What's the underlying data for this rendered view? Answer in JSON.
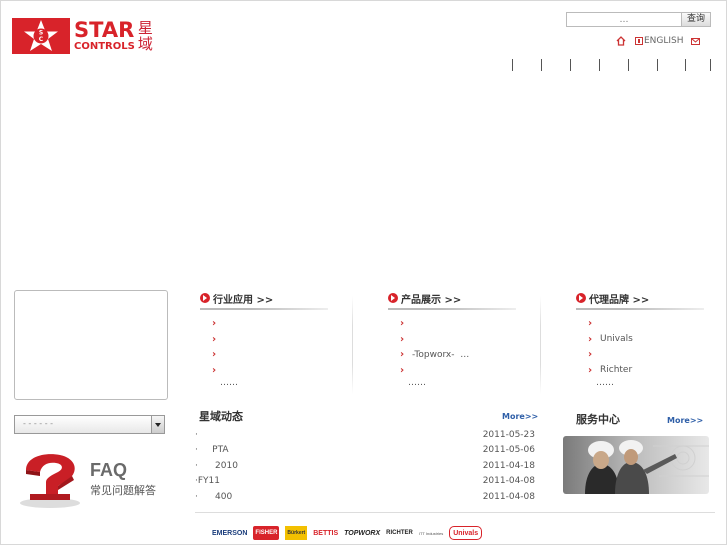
{
  "header": {
    "logo": {
      "brand": "STAR",
      "sub": "CONTROLS",
      "cn": "星域",
      "badge_letters": "SC"
    },
    "search": {
      "placeholder": "…",
      "button_label": "查询"
    },
    "toplinks": {
      "lang_label": "ENGLISH",
      "icons": [
        "home-icon",
        "language-icon",
        "mail-icon"
      ]
    },
    "nav_separators": 8
  },
  "sections": {
    "industry": {
      "title": "行业应用 >>",
      "items": [
        "",
        "",
        "",
        ""
      ],
      "more": "……"
    },
    "products": {
      "title": "产品展示 >>",
      "items": [
        "",
        "",
        "-Topworx-  …",
        ""
      ],
      "more": "……"
    },
    "brands": {
      "title": "代理品牌 >>",
      "items": [
        "",
        "Univals",
        "",
        "Richter"
      ],
      "more": "……"
    }
  },
  "left": {
    "select_value": "- - -     - - -",
    "faq": {
      "title": "FAQ",
      "subtitle": "常见问题解答"
    }
  },
  "news": {
    "title": "星域动态",
    "more": "More>>",
    "items": [
      {
        "title": "·",
        "date": "2011-05-23"
      },
      {
        "title": "·     PTA",
        "date": "2011-05-06"
      },
      {
        "title": "·      2010",
        "date": "2011-04-18"
      },
      {
        "title": "·FY11",
        "date": "2011-04-08"
      },
      {
        "title": "·      400",
        "date": "2011-04-08"
      }
    ]
  },
  "service": {
    "title": "服务中心",
    "more": "More>>"
  },
  "footer_brands": [
    "EMERSON",
    "FISHER",
    "Bürkert",
    "BETTIS",
    "TOPWORX",
    "RICHTER",
    "ITT Industries",
    "Univals"
  ],
  "colors": {
    "accent": "#d8232a",
    "link_blue": "#2f5fa8"
  }
}
